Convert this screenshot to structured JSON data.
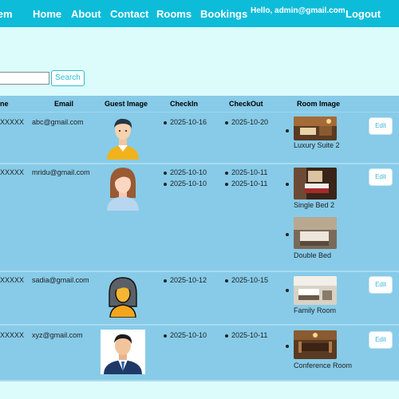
{
  "nav": {
    "brand": "ystem",
    "links": [
      "Home",
      "About",
      "Contact",
      "Rooms",
      "Bookings"
    ],
    "greeting": "Hello, admin@gmail.com",
    "logout": "Logout"
  },
  "search": {
    "value": "",
    "button": "Search"
  },
  "table": {
    "headers": [
      "ne",
      "Email",
      "Guest Image",
      "CheckIn",
      "CheckOut",
      "Room Image"
    ],
    "rows": [
      {
        "name": "XXXXX",
        "email": "abc@gmail.com",
        "checkin": [
          "2025-10-16"
        ],
        "checkout": [
          "2025-10-20"
        ],
        "rooms": [
          "Luxury Suite 2"
        ],
        "edit": "Edit"
      },
      {
        "name": "XXXXX",
        "email": "mridu@gmail.com",
        "checkin": [
          "2025-10-10",
          "2025-10-10"
        ],
        "checkout": [
          "2025-10-11",
          "2025-10-11"
        ],
        "rooms": [
          "Single Bed 2",
          "Double Bed"
        ],
        "edit": "Edit"
      },
      {
        "name": "XXXXX",
        "email": "sadia@gmail.com",
        "checkin": [
          "2025-10-12"
        ],
        "checkout": [
          "2025-10-15"
        ],
        "rooms": [
          "Family Room"
        ],
        "edit": "Edit"
      },
      {
        "name": "XXXXX",
        "email": "xyz@gmail.com",
        "checkin": [
          "2025-10-10"
        ],
        "checkout": [
          "2025-10-11"
        ],
        "rooms": [
          "Conference Room"
        ],
        "edit": "Edit"
      }
    ]
  },
  "colors": {
    "navbar": "#0dbcd9",
    "page_bg": "#dcfbfb",
    "table_bg": "#87cbe8",
    "button_text": "#3fb6d8"
  }
}
